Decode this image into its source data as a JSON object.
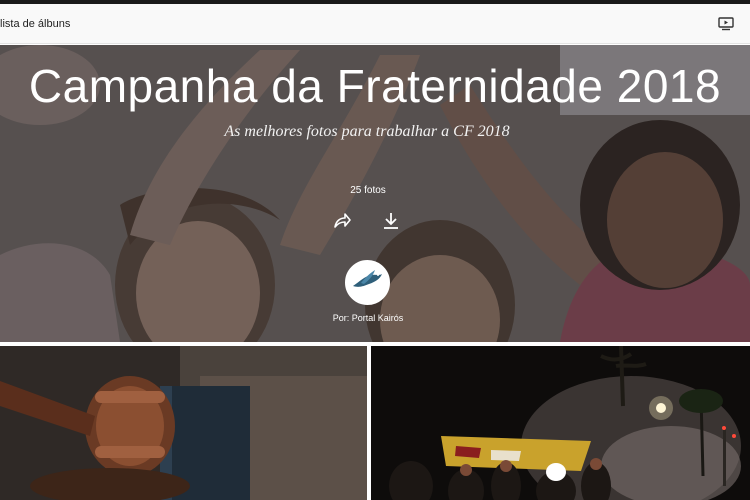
{
  "topbar": {
    "back_label": "lista de álbuns",
    "slideshow_icon": "slideshow-icon"
  },
  "album": {
    "title": "Campanha da Fraternidade 2018",
    "subtitle": "As melhores fotos para trabalhar a CF 2018",
    "photo_count": "25 fotos",
    "author": "Por: Portal Kairós",
    "share_icon": "share-icon",
    "download_icon": "download-icon"
  },
  "thumbnails": [
    {
      "subject": "gavel-photo"
    },
    {
      "subject": "protest-night-photo"
    }
  ],
  "colors": {
    "overlay": "#4a4542",
    "topbar_bg": "#f9f9f9",
    "text_on_hero": "#ffffff"
  }
}
